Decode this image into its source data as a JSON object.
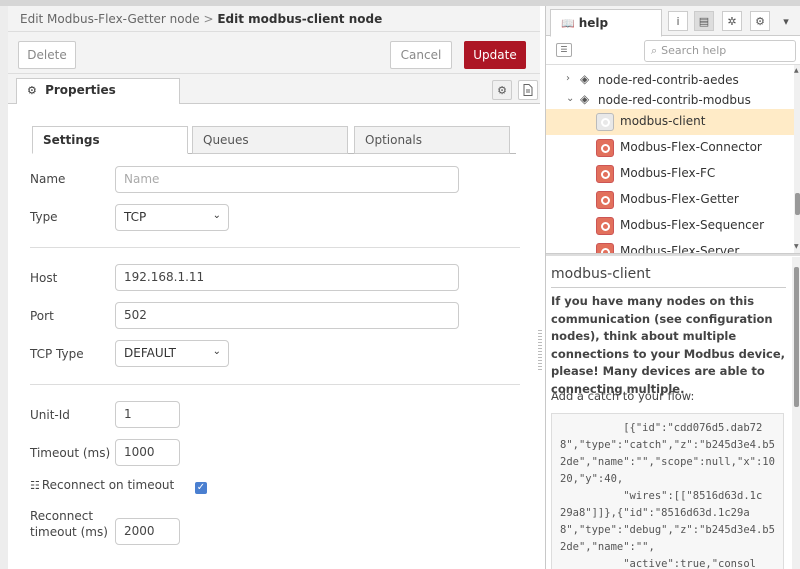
{
  "editor": {
    "breadcrumb_parent": "Edit Modbus-Flex-Getter node",
    "breadcrumb_sep": ">",
    "breadcrumb_current": "Edit modbus-client node",
    "delete_label": "Delete",
    "cancel_label": "Cancel",
    "update_label": "Update",
    "properties_tab": "Properties",
    "tabs": [
      {
        "label": "Settings",
        "active": true
      },
      {
        "label": "Queues",
        "active": false
      },
      {
        "label": "Optionals",
        "active": false
      }
    ],
    "fields": {
      "name_label": "Name",
      "name_placeholder": "Name",
      "type_label": "Type",
      "type_value": "TCP",
      "host_label": "Host",
      "host_value": "192.168.1.11",
      "port_label": "Port",
      "port_value": "502",
      "tcp_type_label": "TCP Type",
      "tcp_type_value": "DEFAULT",
      "unit_id_label": "Unit-Id",
      "unit_id_value": "1",
      "timeout_label": "Timeout (ms)",
      "timeout_value": "1000",
      "reconnect_label": "Reconnect on timeout",
      "reconnect_checked": true,
      "reconnect_timeout_label_1": "Reconnect",
      "reconnect_timeout_label_2": "timeout (ms)",
      "reconnect_timeout_value": "2000"
    },
    "accent_color": "#ad1625"
  },
  "sidebar": {
    "tab_label": "help",
    "search_placeholder": "Search help",
    "tree": [
      {
        "label": "node-red-contrib-aedes",
        "expanded": false
      },
      {
        "label": "node-red-contrib-modbus",
        "expanded": true
      }
    ],
    "nodes": [
      {
        "label": "modbus-client",
        "selected": true
      },
      {
        "label": "Modbus-Flex-Connector",
        "selected": false
      },
      {
        "label": "Modbus-Flex-FC",
        "selected": false
      },
      {
        "label": "Modbus-Flex-Getter",
        "selected": false
      },
      {
        "label": "Modbus-Flex-Sequencer",
        "selected": false
      },
      {
        "label": "Modbus-Flex-Server",
        "selected": false
      }
    ],
    "help": {
      "title": "modbus-client",
      "paragraph": "If you have many nodes on this communication (see configuration nodes), think about multiple connections to your Modbus device, please! Many devices are able to connecting multiple.",
      "catch_text": "Add a catch to your flow:",
      "code": "          [{\"id\":\"cdd076d5.dab72\n8\",\"type\":\"catch\",\"z\":\"b245d3e4.b5\n2de\",\"name\":\"\",\"scope\":null,\"x\":10\n20,\"y\":40,\n          \"wires\":[[\"8516d63d.1c\n29a8\"]]},{\"id\":\"8516d63d.1c29a\n8\",\"type\":\"debug\",\"z\":\"b245d3e4.b5\n2de\",\"name\":\"\",\n          \"active\":true,\"consol"
    }
  }
}
